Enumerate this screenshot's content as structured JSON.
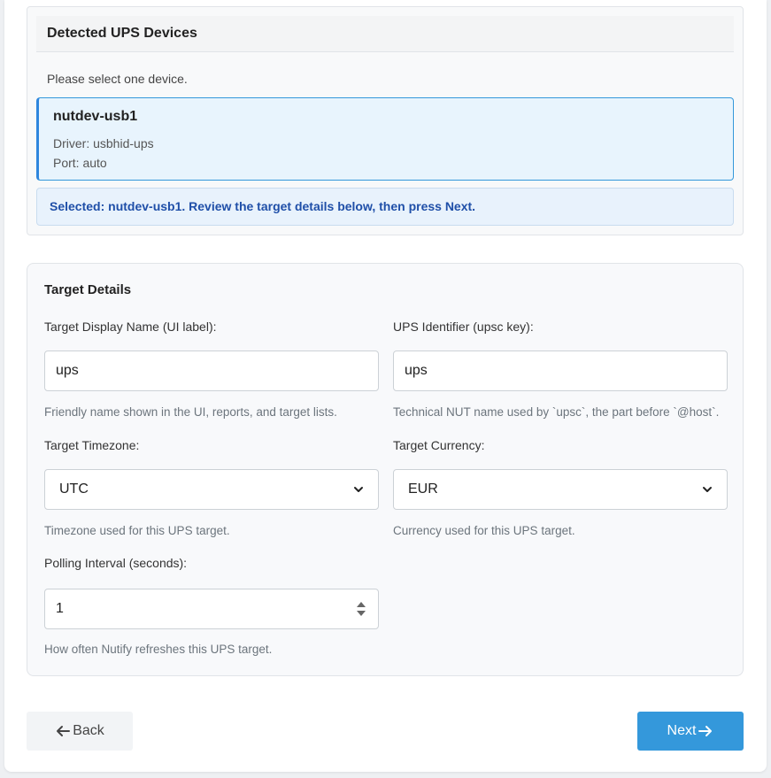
{
  "detected": {
    "title": "Detected UPS Devices",
    "hint": "Please select one device.",
    "device": {
      "name": "nutdev-usb1",
      "driver_line": "Driver: usbhid-ups",
      "port_line": "Port: auto"
    },
    "selected_notice": "Selected: nutdev-usb1. Review the target details below, then press Next."
  },
  "target": {
    "title": "Target Details",
    "display_name": {
      "label": "Target Display Name (UI label):",
      "value": "ups",
      "help": "Friendly name shown in the UI, reports, and target lists."
    },
    "ups_identifier": {
      "label": "UPS Identifier (upsc key):",
      "value": "ups",
      "help": "Technical NUT name used by `upsc`, the part before `@host`."
    },
    "timezone": {
      "label": "Target Timezone:",
      "value": "UTC",
      "help": "Timezone used for this UPS target."
    },
    "currency": {
      "label": "Target Currency:",
      "value": "EUR",
      "help": "Currency used for this UPS target."
    },
    "polling": {
      "label": "Polling Interval (seconds):",
      "value": "1",
      "help": "How often Nutify refreshes this UPS target."
    }
  },
  "nav": {
    "back_label": "Back",
    "next_label": "Next"
  },
  "colors": {
    "accent": "#3498db",
    "selected_border": "#2e86de",
    "selected_text": "#1f4fa8"
  }
}
